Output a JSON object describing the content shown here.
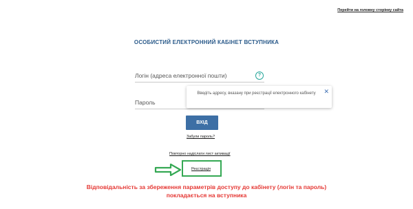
{
  "header": {
    "main_page_link": "Перейти на головну сторінку сайта"
  },
  "page_title": "ОСОБИСТИЙ ЕЛЕКТРОННИЙ КАБІНЕТ ВСТУПНИКА",
  "form": {
    "login_label": "Логін (адреса електронної пошти)",
    "password_label": "Пароль",
    "help_icon_glyph": "?",
    "submit_label": "ВХІД",
    "forgot_password_link": "Забули пароль?",
    "resend_activation_link": "Повторно надіслати лист активації",
    "register_link": "Реєстрація"
  },
  "tooltip": {
    "text": "Введіть адресу, вказану при реєстрації електронного кабінету",
    "close_glyph": "✕"
  },
  "warning": {
    "line1": "Відповідальність за збереження параметрів доступу до кабінету (логін та пароль)",
    "line2": "покладається на вступника"
  },
  "colors": {
    "title": "#2a5a8a",
    "button": "#3d6fa5",
    "help_icon": "#26a69a",
    "warning": "#e53935",
    "highlight": "#34a853"
  }
}
